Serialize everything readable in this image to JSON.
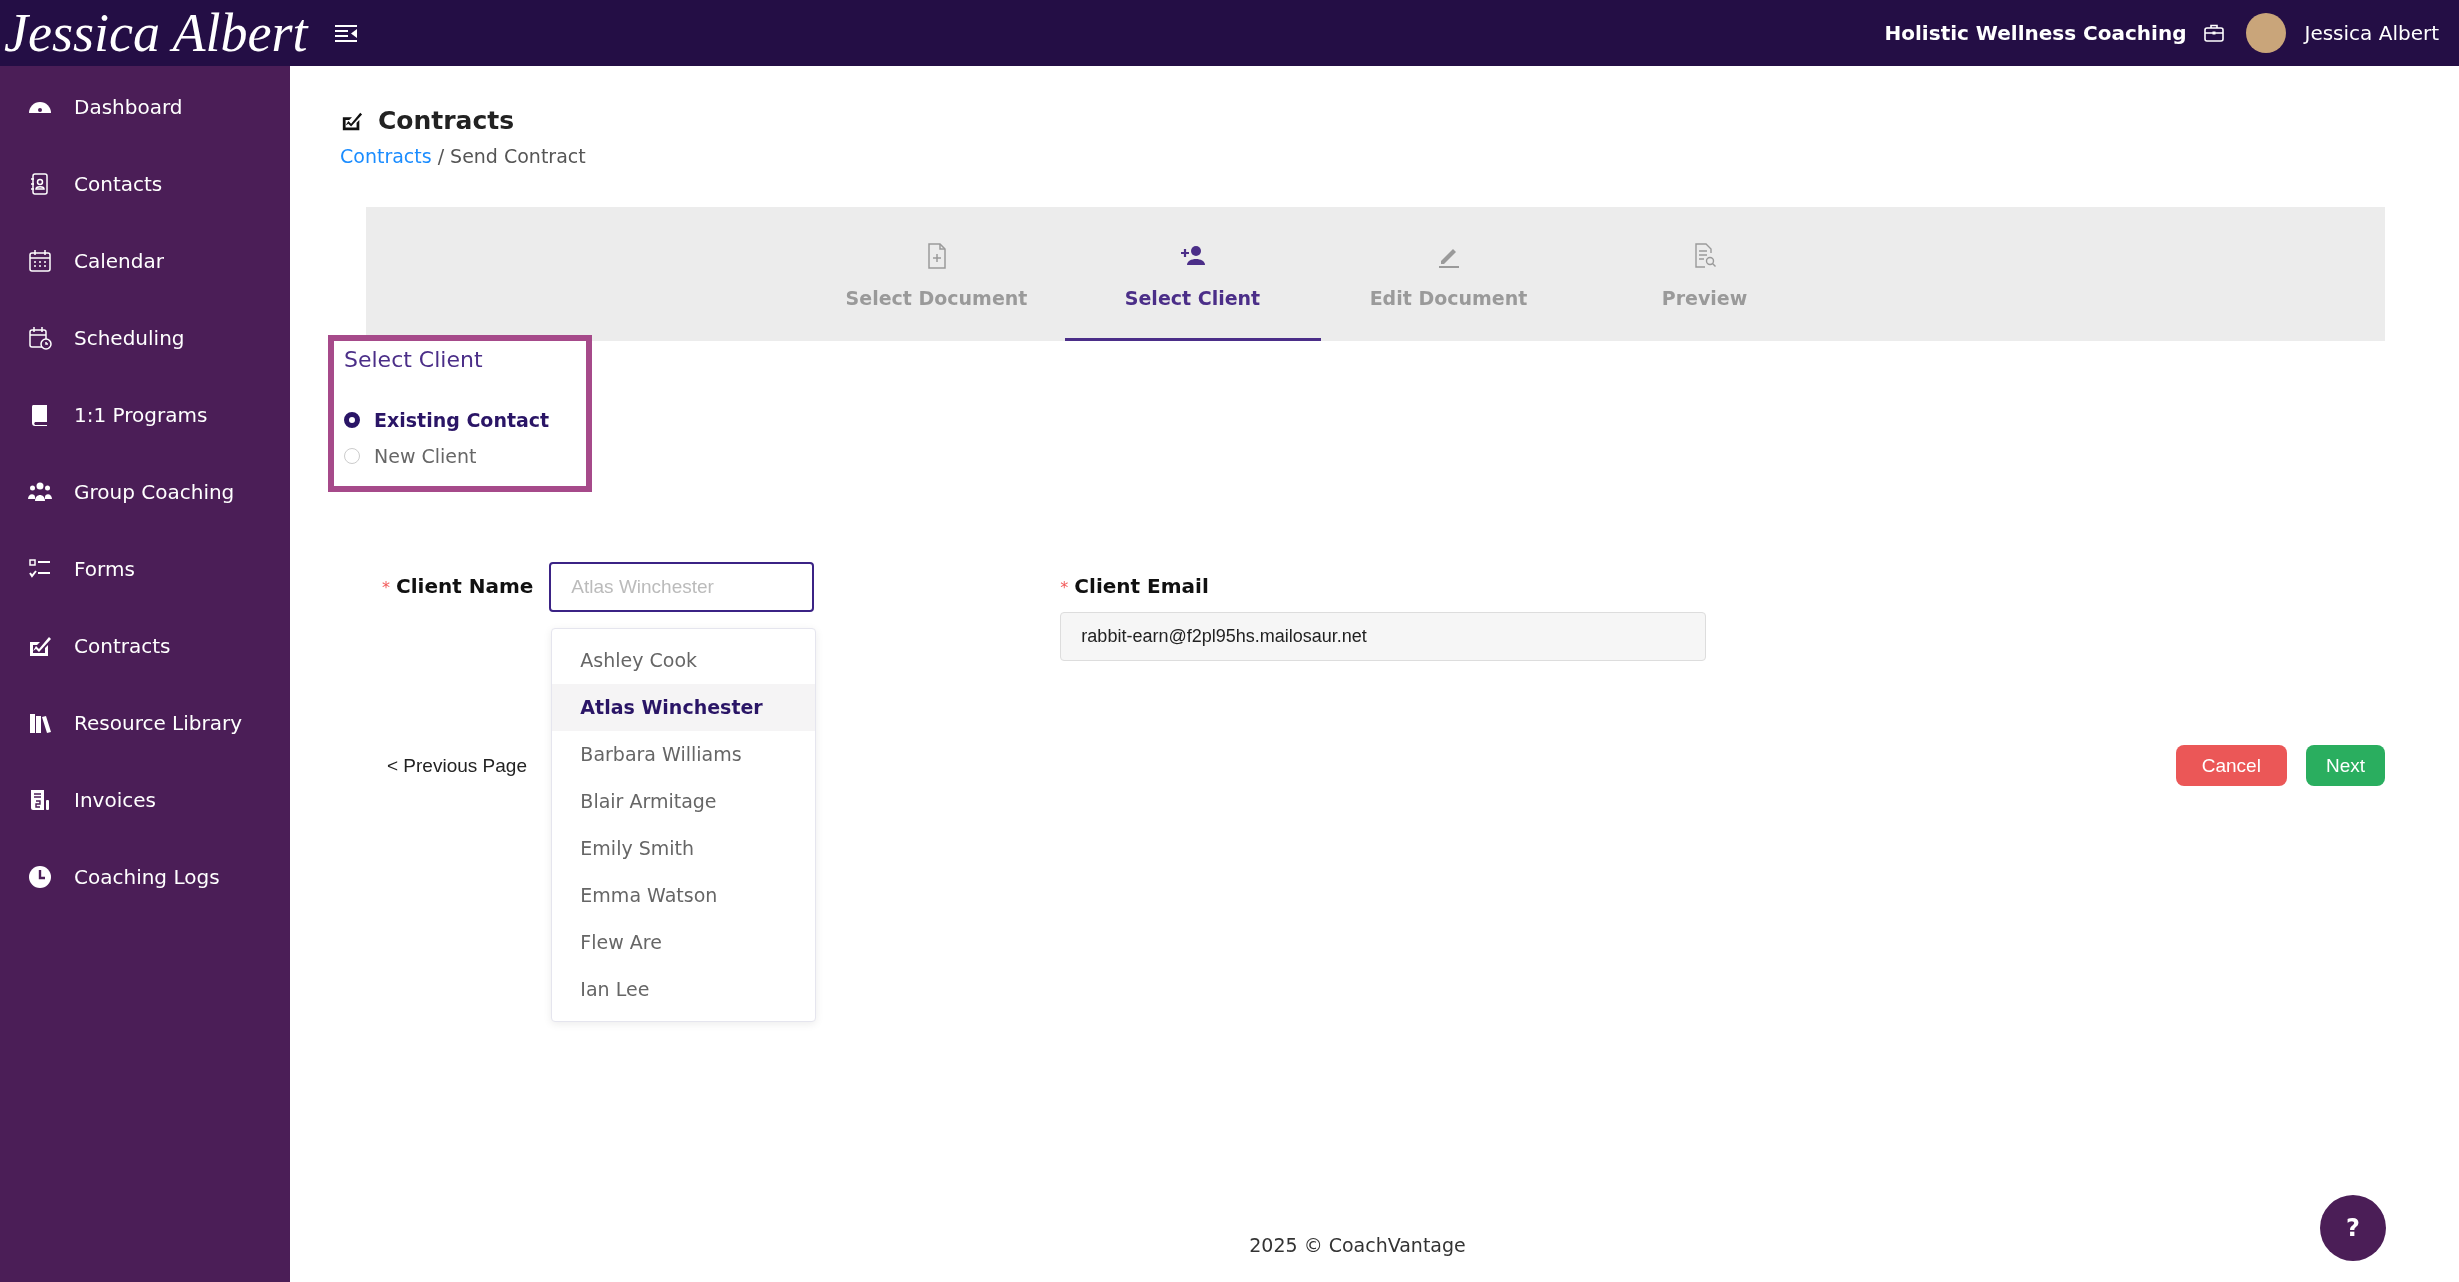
{
  "topbar": {
    "logo": "Jessica Albert",
    "organization": "Holistic Wellness Coaching",
    "user_name": "Jessica Albert"
  },
  "sidebar": {
    "items": [
      {
        "label": "Dashboard",
        "selected": false
      },
      {
        "label": "Contacts",
        "selected": false
      },
      {
        "label": "Calendar",
        "selected": false
      },
      {
        "label": "Scheduling",
        "selected": false
      },
      {
        "label": "1:1 Programs",
        "selected": false
      },
      {
        "label": "Group Coaching",
        "selected": false
      },
      {
        "label": "Forms",
        "selected": false
      },
      {
        "label": "Contracts",
        "selected": false
      },
      {
        "label": "Resource Library",
        "selected": false
      },
      {
        "label": "Invoices",
        "selected": false
      },
      {
        "label": "Coaching Logs",
        "selected": false
      }
    ]
  },
  "page": {
    "title": "Contracts",
    "breadcrumb": [
      {
        "label": "Contracts",
        "kind": "link"
      },
      {
        "label": "/ Send Contract",
        "kind": "current"
      }
    ]
  },
  "steps": [
    {
      "label": "Select Document",
      "selected": false
    },
    {
      "label": "Select Client",
      "selected": true
    },
    {
      "label": "Edit Document",
      "selected": false
    },
    {
      "label": "Preview",
      "selected": false
    }
  ],
  "client_type": {
    "title": "Select Client",
    "options": [
      {
        "label": "Existing Contact",
        "selected": true
      },
      {
        "label": "New Client",
        "selected": false
      }
    ]
  },
  "client_name": {
    "required_mark": "*",
    "label": "Client Name",
    "placeholder": "Atlas Winchester",
    "options": [
      {
        "label": "Ashley Cook",
        "selected": false
      },
      {
        "label": "Atlas Winchester",
        "selected": true
      },
      {
        "label": "Barbara Williams",
        "selected": false
      },
      {
        "label": "Blair Armitage",
        "selected": false
      },
      {
        "label": "Emily Smith",
        "selected": false
      },
      {
        "label": "Emma Watson",
        "selected": false
      },
      {
        "label": "Flew Are",
        "selected": false
      },
      {
        "label": "Ian Lee",
        "selected": false
      }
    ]
  },
  "client_email": {
    "required_mark": "*",
    "label": "Client Email",
    "value": "rabbit-earn@f2pl95hs.mailosaur.net"
  },
  "previous_link": "< Previous Page",
  "buttons": [
    {
      "label": "Cancel",
      "kind": "danger"
    },
    {
      "label": "Next",
      "kind": "success"
    }
  ],
  "footer": "2025 © CoachVantage",
  "help": "?"
}
